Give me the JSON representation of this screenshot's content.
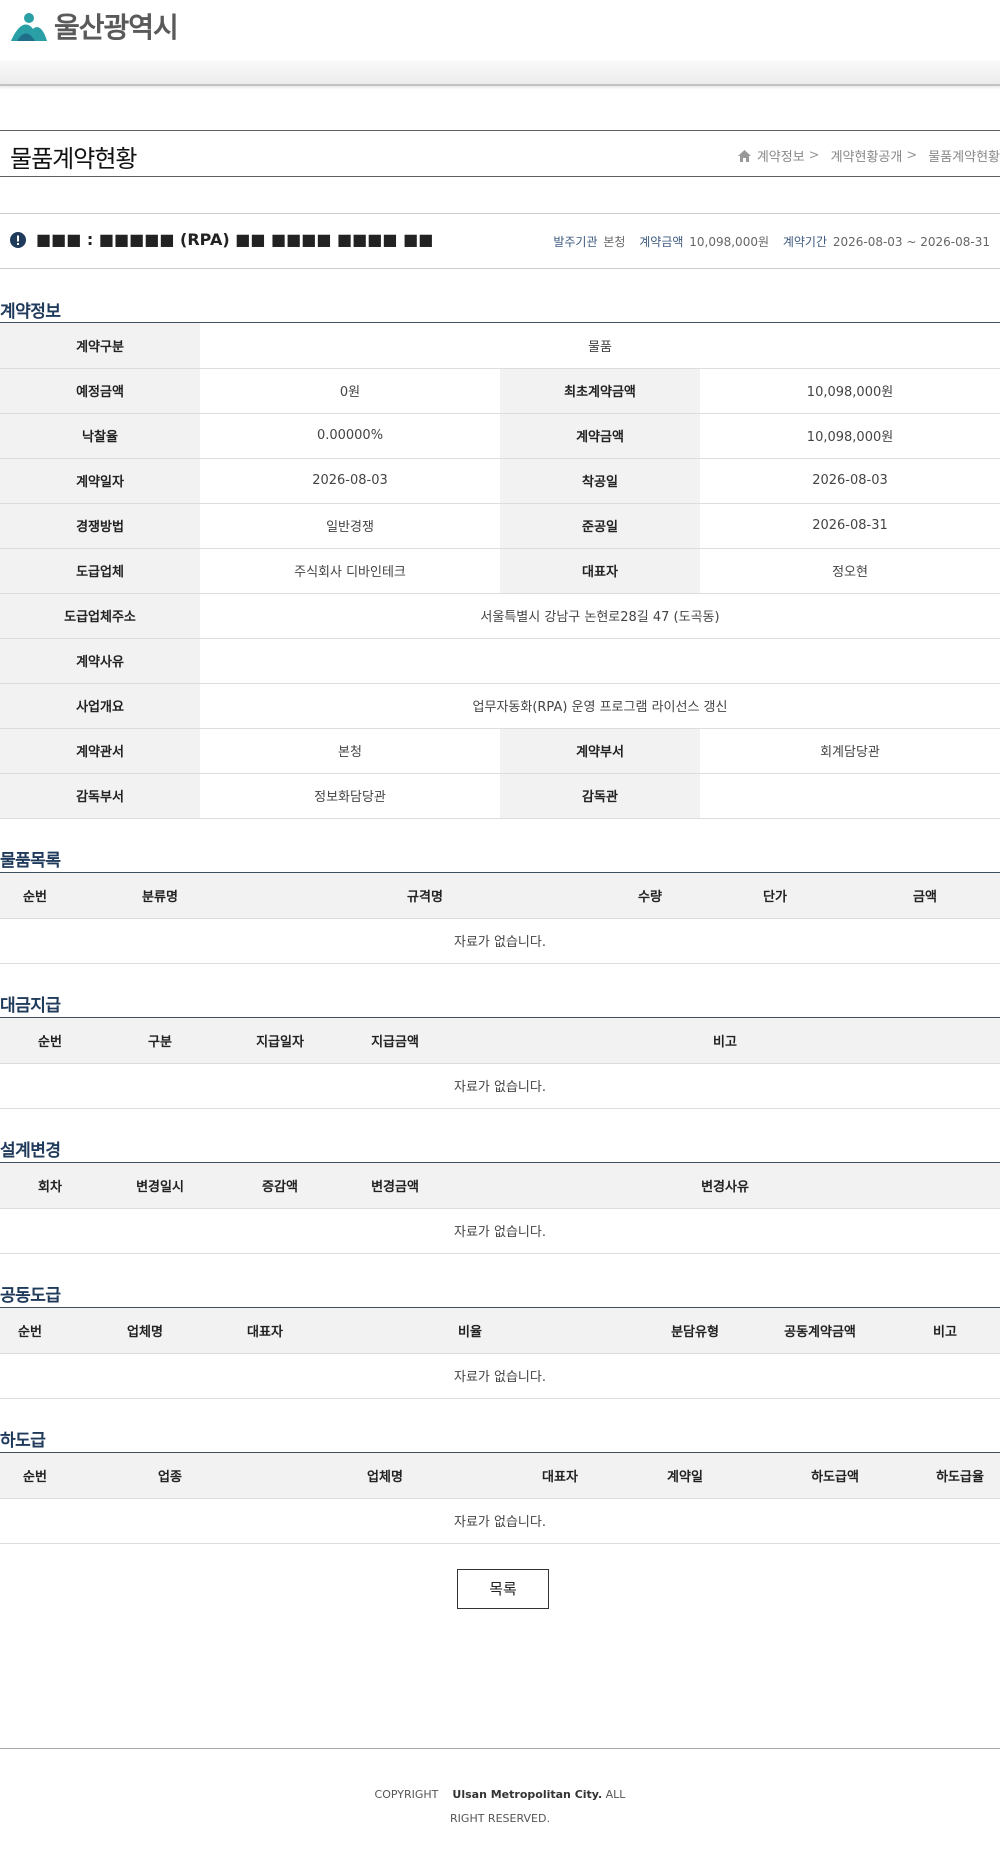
{
  "header": {
    "logo_text": "울산광역시"
  },
  "page": {
    "title": "물품계약현황",
    "breadcrumb": [
      "계약정보",
      "계약현황공개",
      "물품계약현황"
    ]
  },
  "summary": {
    "contract_name": "■■■ : ■■■■■ (RPA) ■■ ■■■■ ■■■■ ■■",
    "meta": [
      {
        "label": "발주기관",
        "value": "본청"
      },
      {
        "label": "계약금액",
        "value": "10,098,000원"
      },
      {
        "label": "계약기간",
        "value": "2026-08-03 ~ 2026-08-31"
      }
    ]
  },
  "contract_info": {
    "section_title": "계약정보",
    "rows": {
      "type": {
        "label": "계약구분",
        "value": "물품"
      },
      "est_amount": {
        "label": "예정금액",
        "value": "0원"
      },
      "first_amount": {
        "label": "최초계약금액",
        "value": "10,098,000원"
      },
      "rate": {
        "label": "낙찰율",
        "value": "0.00000%"
      },
      "amount": {
        "label": "계약금액",
        "value": "10,098,000원"
      },
      "date": {
        "label": "계약일자",
        "value": "2026-08-03"
      },
      "start": {
        "label": "착공일",
        "value": "2026-08-03"
      },
      "method": {
        "label": "경쟁방법",
        "value": "일반경쟁"
      },
      "end": {
        "label": "준공일",
        "value": "2026-08-31"
      },
      "company": {
        "label": "도급업체",
        "value": "주식회사 디바인테크"
      },
      "ceo": {
        "label": "대표자",
        "value": "정오현"
      },
      "address": {
        "label": "도급업체주소",
        "value": "서울특별시 강남구 논현로28길 47 (도곡동)"
      },
      "reason": {
        "label": "계약사유",
        "value": ""
      },
      "overview": {
        "label": "사업개요",
        "value": "업무자동화(RPA) 운영 프로그램 라이선스 갱신"
      },
      "office": {
        "label": "계약관서",
        "value": "본청"
      },
      "dept": {
        "label": "계약부서",
        "value": "회계담당관"
      },
      "sup_dept": {
        "label": "감독부서",
        "value": "정보화담당관"
      },
      "supervisor": {
        "label": "감독관",
        "value": ""
      }
    }
  },
  "goods": {
    "section_title": "물품목록",
    "columns": [
      "순번",
      "분류명",
      "규격명",
      "수량",
      "단가",
      "금액"
    ],
    "empty": "자료가 없습니다."
  },
  "payment": {
    "section_title": "대금지급",
    "columns": [
      "순번",
      "구분",
      "지급일자",
      "지급금액",
      "비고"
    ],
    "empty": "자료가 없습니다."
  },
  "design_change": {
    "section_title": "설계변경",
    "columns": [
      "회차",
      "변경일시",
      "증감액",
      "변경금액",
      "변경사유"
    ],
    "empty": "자료가 없습니다."
  },
  "joint": {
    "section_title": "공동도급",
    "columns": [
      "순번",
      "업체명",
      "대표자",
      "비율",
      "분담유형",
      "공동계약금액",
      "비고"
    ],
    "empty": "자료가 없습니다."
  },
  "subcontract": {
    "section_title": "하도급",
    "columns": [
      "순번",
      "업종",
      "업체명",
      "대표자",
      "계약일",
      "하도급액",
      "하도급율"
    ],
    "empty": "자료가 없습니다."
  },
  "buttons": {
    "list": "목록"
  },
  "footer": {
    "copyright_prefix": "COPYRIGHT",
    "copyright_owner": "Ulsan Metropolitan City.",
    "copyright_suffix": "ALL RIGHT RESERVED."
  },
  "colors": {
    "section_title": "#1f3a5a",
    "logo_teal": "#2a9fa6",
    "header_bg": "#f2f2f2"
  }
}
